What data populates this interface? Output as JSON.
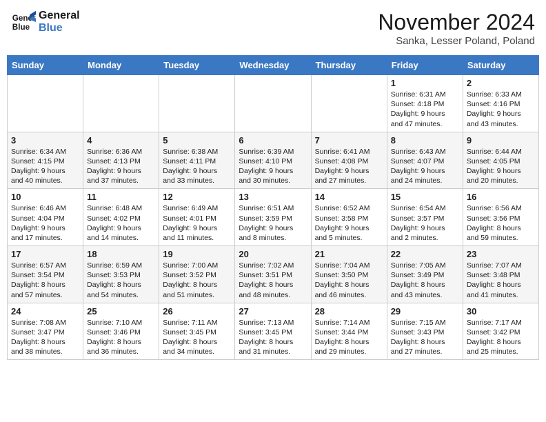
{
  "logo": {
    "line1": "General",
    "line2": "Blue"
  },
  "title": "November 2024",
  "location": "Sanka, Lesser Poland, Poland",
  "days_of_week": [
    "Sunday",
    "Monday",
    "Tuesday",
    "Wednesday",
    "Thursday",
    "Friday",
    "Saturday"
  ],
  "weeks": [
    [
      {
        "day": "",
        "info": ""
      },
      {
        "day": "",
        "info": ""
      },
      {
        "day": "",
        "info": ""
      },
      {
        "day": "",
        "info": ""
      },
      {
        "day": "",
        "info": ""
      },
      {
        "day": "1",
        "info": "Sunrise: 6:31 AM\nSunset: 4:18 PM\nDaylight: 9 hours and 47 minutes."
      },
      {
        "day": "2",
        "info": "Sunrise: 6:33 AM\nSunset: 4:16 PM\nDaylight: 9 hours and 43 minutes."
      }
    ],
    [
      {
        "day": "3",
        "info": "Sunrise: 6:34 AM\nSunset: 4:15 PM\nDaylight: 9 hours and 40 minutes."
      },
      {
        "day": "4",
        "info": "Sunrise: 6:36 AM\nSunset: 4:13 PM\nDaylight: 9 hours and 37 minutes."
      },
      {
        "day": "5",
        "info": "Sunrise: 6:38 AM\nSunset: 4:11 PM\nDaylight: 9 hours and 33 minutes."
      },
      {
        "day": "6",
        "info": "Sunrise: 6:39 AM\nSunset: 4:10 PM\nDaylight: 9 hours and 30 minutes."
      },
      {
        "day": "7",
        "info": "Sunrise: 6:41 AM\nSunset: 4:08 PM\nDaylight: 9 hours and 27 minutes."
      },
      {
        "day": "8",
        "info": "Sunrise: 6:43 AM\nSunset: 4:07 PM\nDaylight: 9 hours and 24 minutes."
      },
      {
        "day": "9",
        "info": "Sunrise: 6:44 AM\nSunset: 4:05 PM\nDaylight: 9 hours and 20 minutes."
      }
    ],
    [
      {
        "day": "10",
        "info": "Sunrise: 6:46 AM\nSunset: 4:04 PM\nDaylight: 9 hours and 17 minutes."
      },
      {
        "day": "11",
        "info": "Sunrise: 6:48 AM\nSunset: 4:02 PM\nDaylight: 9 hours and 14 minutes."
      },
      {
        "day": "12",
        "info": "Sunrise: 6:49 AM\nSunset: 4:01 PM\nDaylight: 9 hours and 11 minutes."
      },
      {
        "day": "13",
        "info": "Sunrise: 6:51 AM\nSunset: 3:59 PM\nDaylight: 9 hours and 8 minutes."
      },
      {
        "day": "14",
        "info": "Sunrise: 6:52 AM\nSunset: 3:58 PM\nDaylight: 9 hours and 5 minutes."
      },
      {
        "day": "15",
        "info": "Sunrise: 6:54 AM\nSunset: 3:57 PM\nDaylight: 9 hours and 2 minutes."
      },
      {
        "day": "16",
        "info": "Sunrise: 6:56 AM\nSunset: 3:56 PM\nDaylight: 8 hours and 59 minutes."
      }
    ],
    [
      {
        "day": "17",
        "info": "Sunrise: 6:57 AM\nSunset: 3:54 PM\nDaylight: 8 hours and 57 minutes."
      },
      {
        "day": "18",
        "info": "Sunrise: 6:59 AM\nSunset: 3:53 PM\nDaylight: 8 hours and 54 minutes."
      },
      {
        "day": "19",
        "info": "Sunrise: 7:00 AM\nSunset: 3:52 PM\nDaylight: 8 hours and 51 minutes."
      },
      {
        "day": "20",
        "info": "Sunrise: 7:02 AM\nSunset: 3:51 PM\nDaylight: 8 hours and 48 minutes."
      },
      {
        "day": "21",
        "info": "Sunrise: 7:04 AM\nSunset: 3:50 PM\nDaylight: 8 hours and 46 minutes."
      },
      {
        "day": "22",
        "info": "Sunrise: 7:05 AM\nSunset: 3:49 PM\nDaylight: 8 hours and 43 minutes."
      },
      {
        "day": "23",
        "info": "Sunrise: 7:07 AM\nSunset: 3:48 PM\nDaylight: 8 hours and 41 minutes."
      }
    ],
    [
      {
        "day": "24",
        "info": "Sunrise: 7:08 AM\nSunset: 3:47 PM\nDaylight: 8 hours and 38 minutes."
      },
      {
        "day": "25",
        "info": "Sunrise: 7:10 AM\nSunset: 3:46 PM\nDaylight: 8 hours and 36 minutes."
      },
      {
        "day": "26",
        "info": "Sunrise: 7:11 AM\nSunset: 3:45 PM\nDaylight: 8 hours and 34 minutes."
      },
      {
        "day": "27",
        "info": "Sunrise: 7:13 AM\nSunset: 3:45 PM\nDaylight: 8 hours and 31 minutes."
      },
      {
        "day": "28",
        "info": "Sunrise: 7:14 AM\nSunset: 3:44 PM\nDaylight: 8 hours and 29 minutes."
      },
      {
        "day": "29",
        "info": "Sunrise: 7:15 AM\nSunset: 3:43 PM\nDaylight: 8 hours and 27 minutes."
      },
      {
        "day": "30",
        "info": "Sunrise: 7:17 AM\nSunset: 3:42 PM\nDaylight: 8 hours and 25 minutes."
      }
    ]
  ]
}
